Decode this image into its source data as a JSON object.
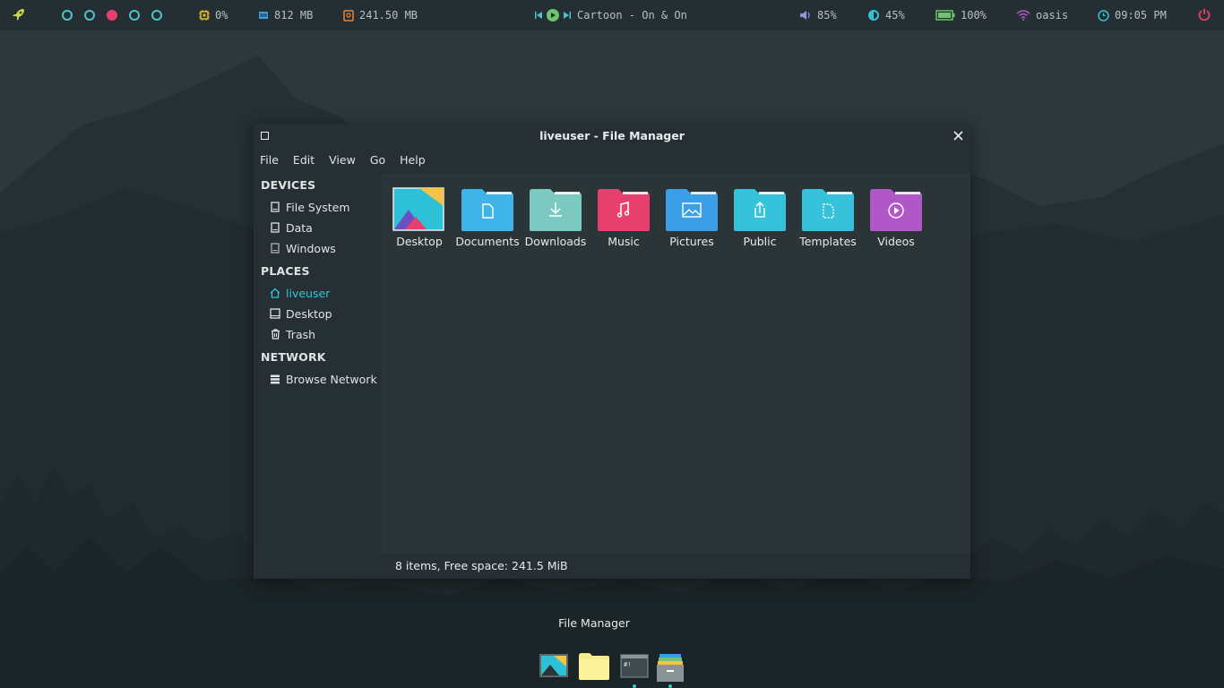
{
  "topbar": {
    "cpu": "0%",
    "memory": "812 MB",
    "disk": "241.50 MB",
    "now_playing": "Cartoon - On & On",
    "volume": "85%",
    "brightness": "45%",
    "battery": "100%",
    "network": "oasis",
    "clock": "09:05 PM",
    "workspaces": [
      false,
      false,
      true,
      false,
      false
    ]
  },
  "window": {
    "title": "liveuser - File Manager",
    "menu": [
      "File",
      "Edit",
      "View",
      "Go",
      "Help"
    ]
  },
  "sidebar": {
    "devices_heading": "DEVICES",
    "devices": [
      "File System",
      "Data",
      "Windows"
    ],
    "places_heading": "PLACES",
    "places": [
      "liveuser",
      "Desktop",
      "Trash"
    ],
    "network_heading": "NETWORK",
    "network": [
      "Browse Network"
    ]
  },
  "folders": [
    {
      "name": "Desktop",
      "icon": "desktop-folder-icon",
      "color": "#2ec0d6"
    },
    {
      "name": "Documents",
      "icon": "document-folder-icon",
      "color": "#3fb4ea"
    },
    {
      "name": "Downloads",
      "icon": "download-folder-icon",
      "color": "#7bc9c0"
    },
    {
      "name": "Music",
      "icon": "music-folder-icon",
      "color": "#e8406e"
    },
    {
      "name": "Pictures",
      "icon": "pictures-folder-icon",
      "color": "#3a9fe6"
    },
    {
      "name": "Public",
      "icon": "public-folder-icon",
      "color": "#35c2da"
    },
    {
      "name": "Templates",
      "icon": "templates-folder-icon",
      "color": "#35c2da"
    },
    {
      "name": "Videos",
      "icon": "videos-folder-icon",
      "color": "#b158c9"
    }
  ],
  "status": "8 items, Free space: 241.5 MiB",
  "dock": {
    "tooltip": "File Manager"
  },
  "colors": {
    "accent": "#33c3d6",
    "active_workspace": "#e8406e",
    "bar_bg": "#252f33",
    "window_bg": "#263034"
  }
}
